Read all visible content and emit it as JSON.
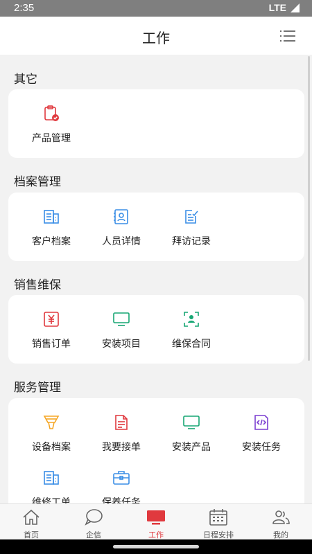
{
  "status": {
    "time": "2:35",
    "network": "LTE"
  },
  "header": {
    "title": "工作"
  },
  "sections": [
    {
      "title": "其它",
      "items": [
        {
          "label": "产品管理",
          "icon": "clipboard-check-icon"
        }
      ]
    },
    {
      "title": "档案管理",
      "items": [
        {
          "label": "客户档案",
          "icon": "building-icon"
        },
        {
          "label": "人员详情",
          "icon": "person-card-icon"
        },
        {
          "label": "拜访记录",
          "icon": "edit-document-icon"
        }
      ]
    },
    {
      "title": "销售维保",
      "items": [
        {
          "label": "销售订单",
          "icon": "yen-icon"
        },
        {
          "label": "安装项目",
          "icon": "monitor-icon"
        },
        {
          "label": "维保合同",
          "icon": "scan-person-icon"
        }
      ]
    },
    {
      "title": "服务管理",
      "items": [
        {
          "label": "设备档案",
          "icon": "funnel-icon"
        },
        {
          "label": "我要接单",
          "icon": "document-icon"
        },
        {
          "label": "安装产品",
          "icon": "monitor-icon"
        },
        {
          "label": "安装任务",
          "icon": "code-file-icon"
        },
        {
          "label": "维修工单",
          "icon": "building-icon"
        },
        {
          "label": "保养任务",
          "icon": "toolbox-icon"
        }
      ]
    }
  ],
  "tabs": [
    {
      "label": "首页",
      "icon": "home-icon"
    },
    {
      "label": "企信",
      "icon": "chat-icon"
    },
    {
      "label": "工作",
      "icon": "work-monitor-icon",
      "active": true
    },
    {
      "label": "日程安排",
      "icon": "calendar-icon"
    },
    {
      "label": "我的",
      "icon": "people-icon"
    }
  ],
  "colors": {
    "accent": "#e0393e",
    "blue": "#3a8ee6",
    "green": "#17a673",
    "orange": "#f5a623",
    "purple": "#7b3fd1"
  }
}
